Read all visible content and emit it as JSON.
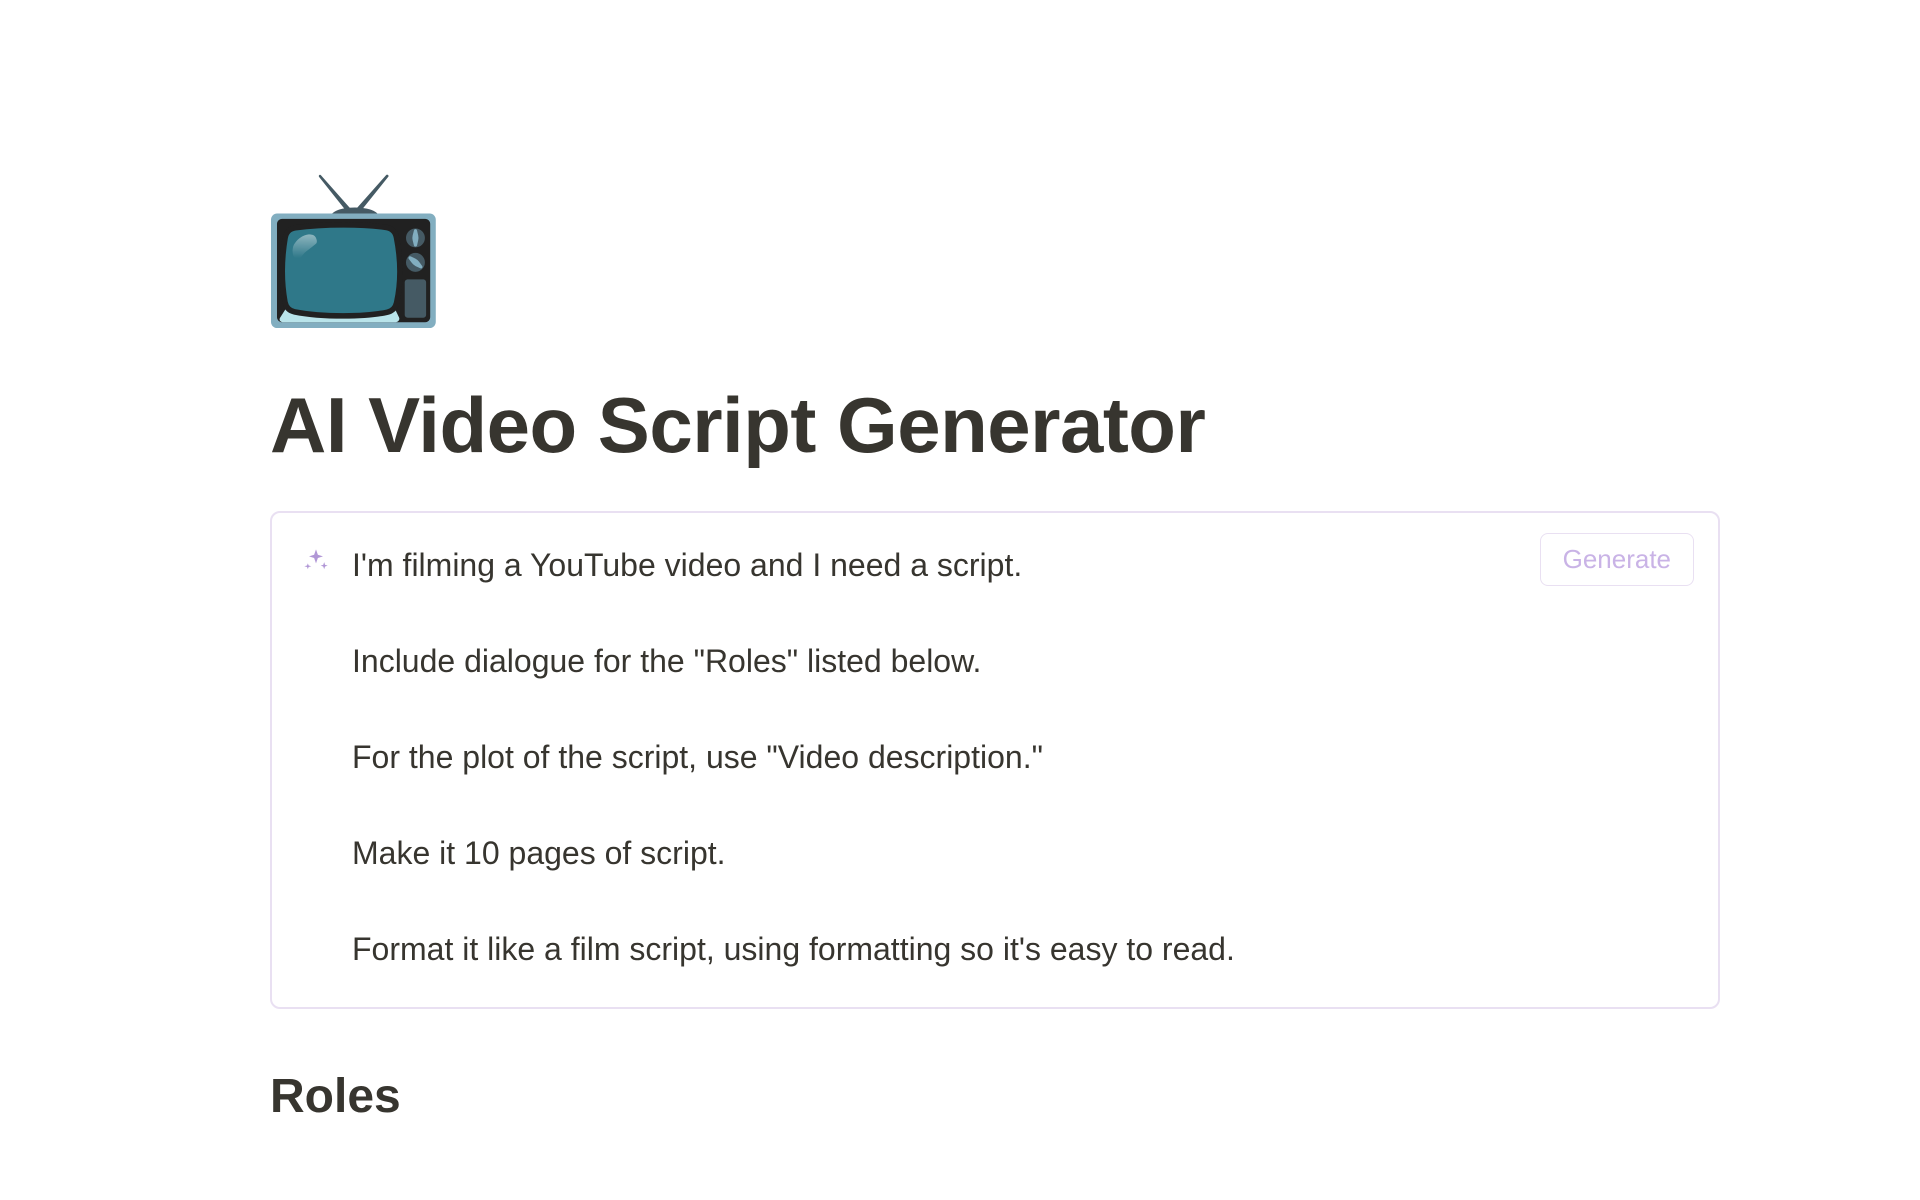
{
  "icon": "📺",
  "title": "AI Video Script Generator",
  "ai_block": {
    "generate_label": "Generate",
    "lines": [
      "I'm filming a YouTube video and I need a script.",
      "Include dialogue for the \"Roles\" listed below.",
      "For the plot of the script, use \"Video description.\"",
      "Make it 10 pages of script.",
      "Format it like a film script, using formatting so it's easy to read."
    ]
  },
  "sections": {
    "roles_heading": "Roles"
  }
}
